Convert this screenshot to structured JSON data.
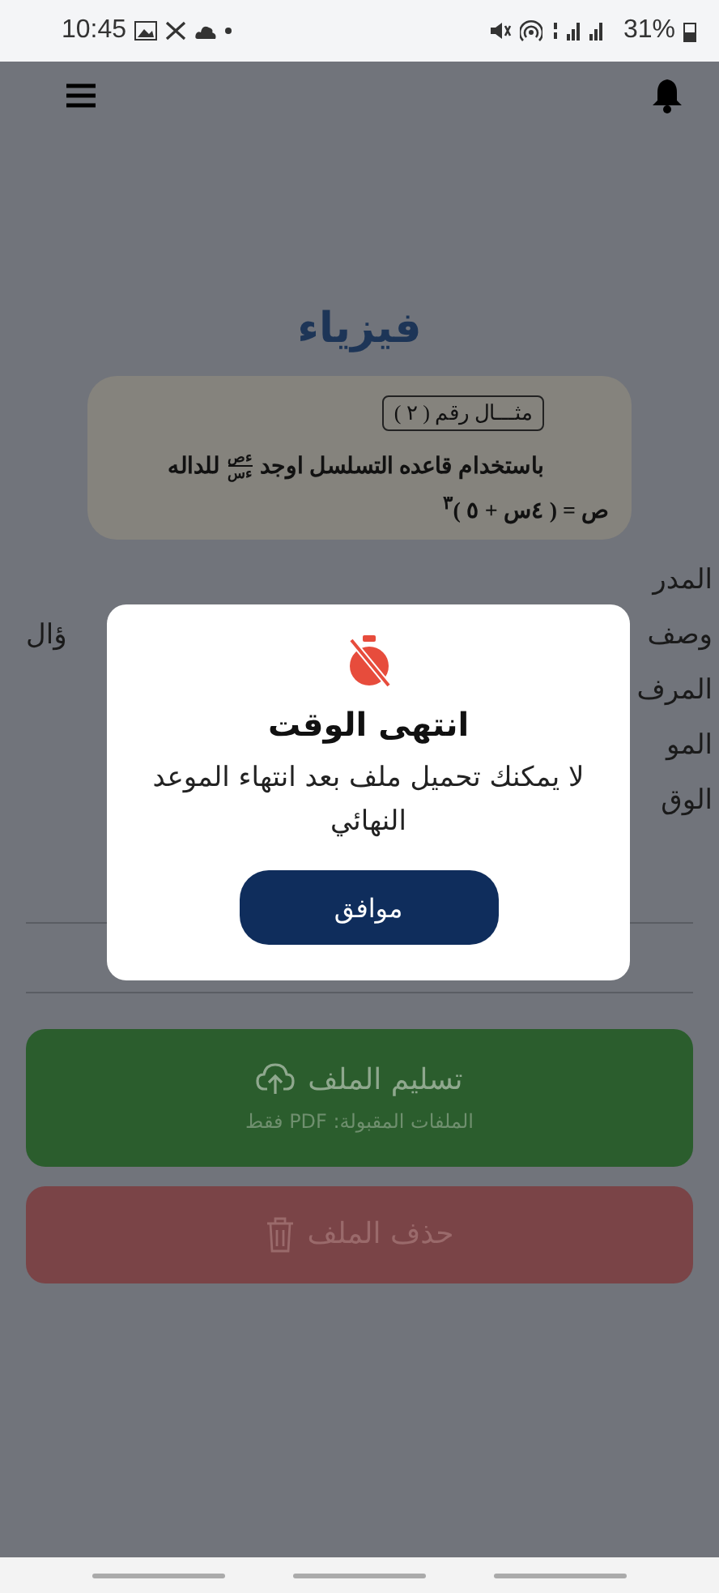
{
  "status_bar": {
    "time": "10:45",
    "battery": "31%"
  },
  "page": {
    "title": "فيزياء",
    "question": {
      "label": "مثـــال رقم ( ٢ )",
      "text": "باستخدام قاعده التسلسل اوجد",
      "fraction_top": "ءص",
      "fraction_bottom": "ءس",
      "text_end": "للداله",
      "formula": "ص = ( ٤س + ٥ )$^{٣}$"
    },
    "detail_fragments": [
      {
        "right": "المدر"
      },
      {
        "right": "وصف",
        "left": "ؤال"
      },
      {
        "right": "المرف"
      },
      {
        "right": "المو"
      },
      {
        "right": "الوق"
      }
    ],
    "upload_button": {
      "label": "تسليم الملف",
      "hint": "الملفات المقبولة: PDF فقط"
    },
    "delete_button": {
      "label": "حذف الملف"
    }
  },
  "dialog": {
    "title": "انتهى الوقت",
    "message": "لا يمكنك تحميل ملف بعد انتهاء الموعد النهائي",
    "button": "موافق"
  }
}
